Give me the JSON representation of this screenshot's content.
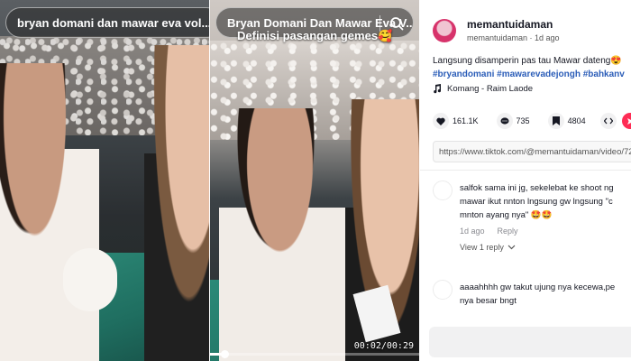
{
  "left_panel": {
    "search_text": "bryan domani dan mawar eva vol..."
  },
  "middle_panel": {
    "search_text": "Bryan Domani Dan Mawar Eva V...",
    "caption": "Definisi pasangan gemes🥰",
    "time_readout": "00:02/00:29",
    "progress_fraction": 0.07
  },
  "post": {
    "author_username": "memantuidaman",
    "author_sub": "memantuidaman · 1d ago",
    "caption_text": "Langsung disamperin pas tau Mawar dateng😍",
    "hashtags": "#bryandomani #mawarevadejongh #bahkanv",
    "sound": "Komang - Raim Laode",
    "likes": "161.1K",
    "comments": "735",
    "saves": "4804",
    "url": "https://www.tiktok.com/@memantuidaman/video/72"
  },
  "comments": [
    {
      "text_line1": "salfok sama ini jg, sekelebat ke shoot ng",
      "text_line2": "mawar ikut nnton lngsung gw lngsung \"c",
      "text_line3": "mnton ayang nya\" 🤩🤩",
      "time": "1d ago",
      "reply_label": "Reply",
      "view_replies": "View 1 reply"
    },
    {
      "text_line1": "aaaahhhh gw takut ujung nya kecewa,pe",
      "text_line2": "nya besar bngt"
    }
  ],
  "colors": {
    "accent_link": "#2b5db8",
    "share_red": "#fe2c55"
  }
}
